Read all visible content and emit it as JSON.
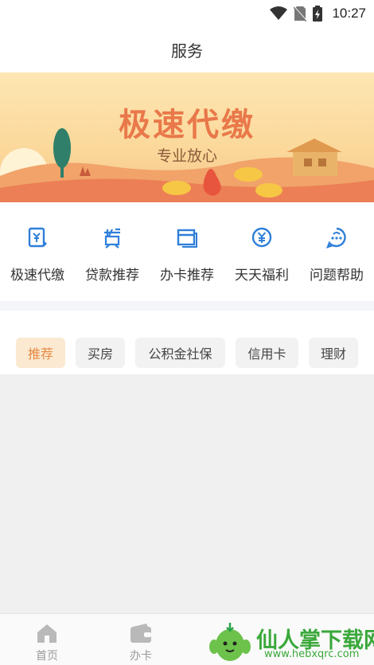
{
  "status_bar": {
    "time": "10:27",
    "icons": [
      "wifi-icon",
      "no-sim-icon",
      "battery-charging-icon"
    ]
  },
  "header": {
    "title": "服务"
  },
  "banner": {
    "title": "极速代缴",
    "subtitle": "专业放心",
    "pager": {
      "count": 2,
      "active": 1
    }
  },
  "services": [
    {
      "label": "极速代缴",
      "icon": "bill-yen-icon"
    },
    {
      "label": "贷款推荐",
      "icon": "loan-icon"
    },
    {
      "label": "办卡推荐",
      "icon": "card-icon"
    },
    {
      "label": "天天福利",
      "icon": "yen-circle-icon"
    },
    {
      "label": "问题帮助",
      "icon": "help-chat-icon"
    }
  ],
  "tabs": [
    {
      "label": "推荐",
      "active": true
    },
    {
      "label": "买房",
      "active": false
    },
    {
      "label": "公积金社保",
      "active": false
    },
    {
      "label": "信用卡",
      "active": false
    },
    {
      "label": "理财",
      "active": false
    }
  ],
  "bottom_nav": [
    {
      "label": "首页",
      "icon": "home-icon"
    },
    {
      "label": "办卡",
      "icon": "wallet-icon"
    },
    {
      "label": "",
      "icon": ""
    },
    {
      "label": "",
      "icon": ""
    }
  ],
  "watermark": {
    "text": "仙人掌下载网",
    "url": "www.hebxqrc.com"
  },
  "colors": {
    "accent": "#e88a45",
    "icon_blue": "#2f7fd9",
    "banner_title": "#e9784a"
  }
}
